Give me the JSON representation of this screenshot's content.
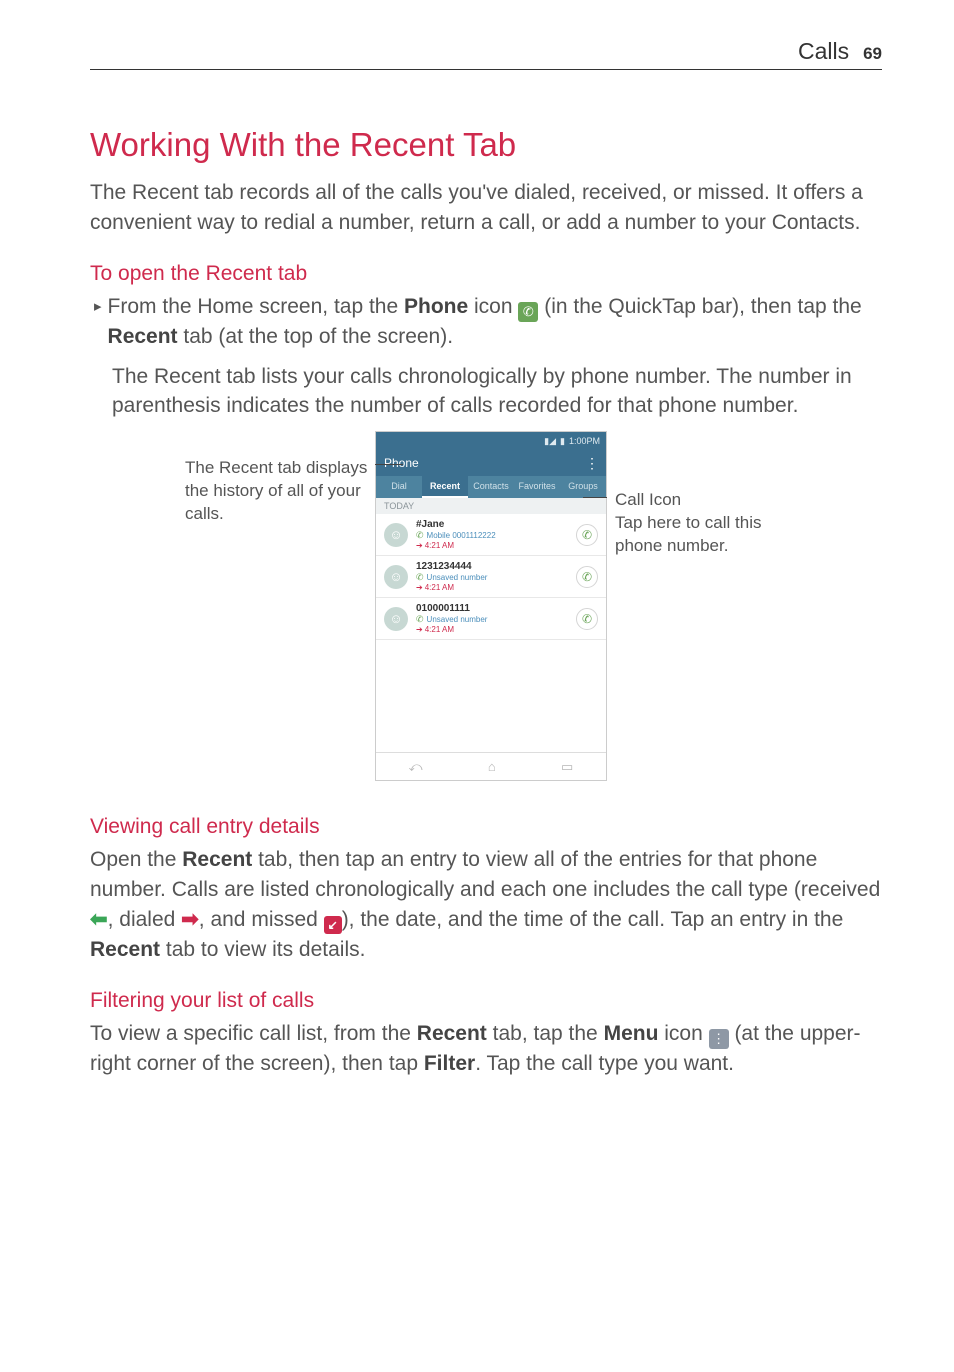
{
  "header": {
    "section": "Calls",
    "page": "69"
  },
  "title": "Working With the Recent Tab",
  "intro": "The Recent tab records all of the calls you've dialed, received, or missed. It offers a convenient way to redial a number, return a call, or add a number to your Contacts.",
  "section_open": {
    "heading": "To open the Recent tab",
    "bullet_pre": "From the Home screen, tap the ",
    "bullet_bold1": "Phone",
    "bullet_mid1": " icon ",
    "bullet_mid2": " (in the QuickTap bar), then tap the ",
    "bullet_bold2": "Recent",
    "bullet_post": " tab (at the top of the screen).",
    "para2": "The Recent tab lists your calls chronologically by phone number. The number in parenthesis indicates the number of calls recorded for that phone number."
  },
  "figure": {
    "left_caption": "The Recent tab displays the history of all of your calls.",
    "right_title": "Call Icon",
    "right_body": "Tap here to call this phone number.",
    "status_time": "1:00PM",
    "app_title": "Phone",
    "tabs": [
      "Dial",
      "Recent",
      "Contacts",
      "Favorites",
      "Groups"
    ],
    "active_tab_index": 1,
    "today": "TODAY",
    "entries": [
      {
        "name": "#Jane",
        "sub": "Mobile 0001112222",
        "time": "4:21 AM"
      },
      {
        "name": "1231234444",
        "sub": "Unsaved number",
        "time": "4:21 AM"
      },
      {
        "name": "0100001111",
        "sub": "Unsaved number",
        "time": "4:21 AM"
      }
    ]
  },
  "section_details": {
    "heading": "Viewing call entry details",
    "p_pre1": "Open the ",
    "bold1": "Recent",
    "p_mid1": " tab, then tap an entry to view all of the entries for that phone number. Calls are listed chronologically and each one includes the call type (received ",
    "p_mid2": ", dialed ",
    "p_mid3": ", and missed ",
    "p_mid4": "), the date, and the time of the call. Tap an entry in the ",
    "bold2": "Recent",
    "p_post": " tab to view its details."
  },
  "section_filter": {
    "heading": "Filtering your list of calls",
    "p_pre": "To view a specific call list, from the ",
    "bold1": "Recent",
    "p_mid1": " tab, tap the ",
    "bold2": "Menu",
    "p_mid2": " icon ",
    "p_mid3": " (at the upper-right corner of the screen), then tap ",
    "bold3": "Filter",
    "p_post": ". Tap the call type you want."
  }
}
